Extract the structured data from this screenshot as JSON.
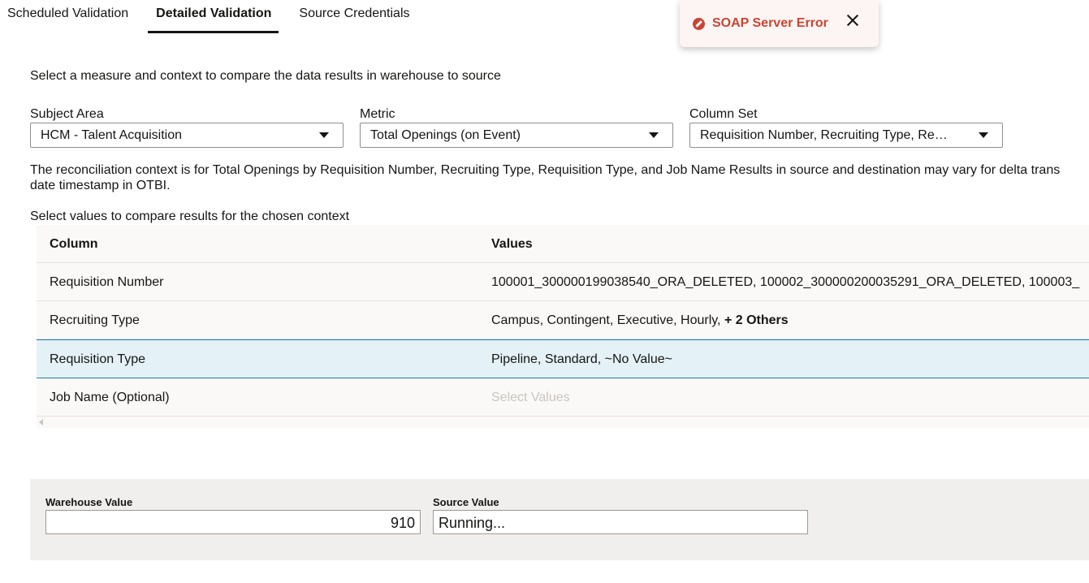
{
  "tabs": [
    {
      "label": "Scheduled Validation"
    },
    {
      "label": "Detailed Validation"
    },
    {
      "label": "Source Credentials"
    }
  ],
  "toast": {
    "message": "SOAP Server Error",
    "icon": "error-circle-icon",
    "color": "#c74634"
  },
  "instruction": "Select a measure and context to compare the data results in warehouse to source",
  "fields": {
    "subject_area": {
      "label": "Subject Area",
      "value": "HCM - Talent Acquisition"
    },
    "metric": {
      "label": "Metric",
      "value": "Total Openings (on Event)"
    },
    "column_set": {
      "label": "Column Set",
      "value": "Requisition Number, Recruiting Type, Re…"
    }
  },
  "context_text": {
    "line1": "The reconciliation context is for Total Openings by Requisition Number, Recruiting Type, Requisition Type, and Job Name Results in source and destination may vary for delta trans",
    "line2": "date timestamp in OTBI."
  },
  "select_values_label": "Select values to compare results for the chosen context",
  "table": {
    "headers": {
      "column": "Column",
      "values": "Values"
    },
    "rows": [
      {
        "column": "Requisition Number",
        "values": "100001_300000199038540_ORA_DELETED, 100002_300000200035291_ORA_DELETED, 100003_"
      },
      {
        "column": "Recruiting Type",
        "values": "Campus, Contingent, Executive, Hourly, ",
        "extra": "+ 2 Others"
      },
      {
        "column": "Requisition Type",
        "values": "Pipeline, Standard, ~No Value~"
      },
      {
        "column": "Job Name (Optional)",
        "placeholder": "Select Values"
      }
    ]
  },
  "panel": {
    "warehouse_label": "Warehouse Value",
    "warehouse_value": "910",
    "source_label": "Source Value",
    "source_value": "Running..."
  }
}
